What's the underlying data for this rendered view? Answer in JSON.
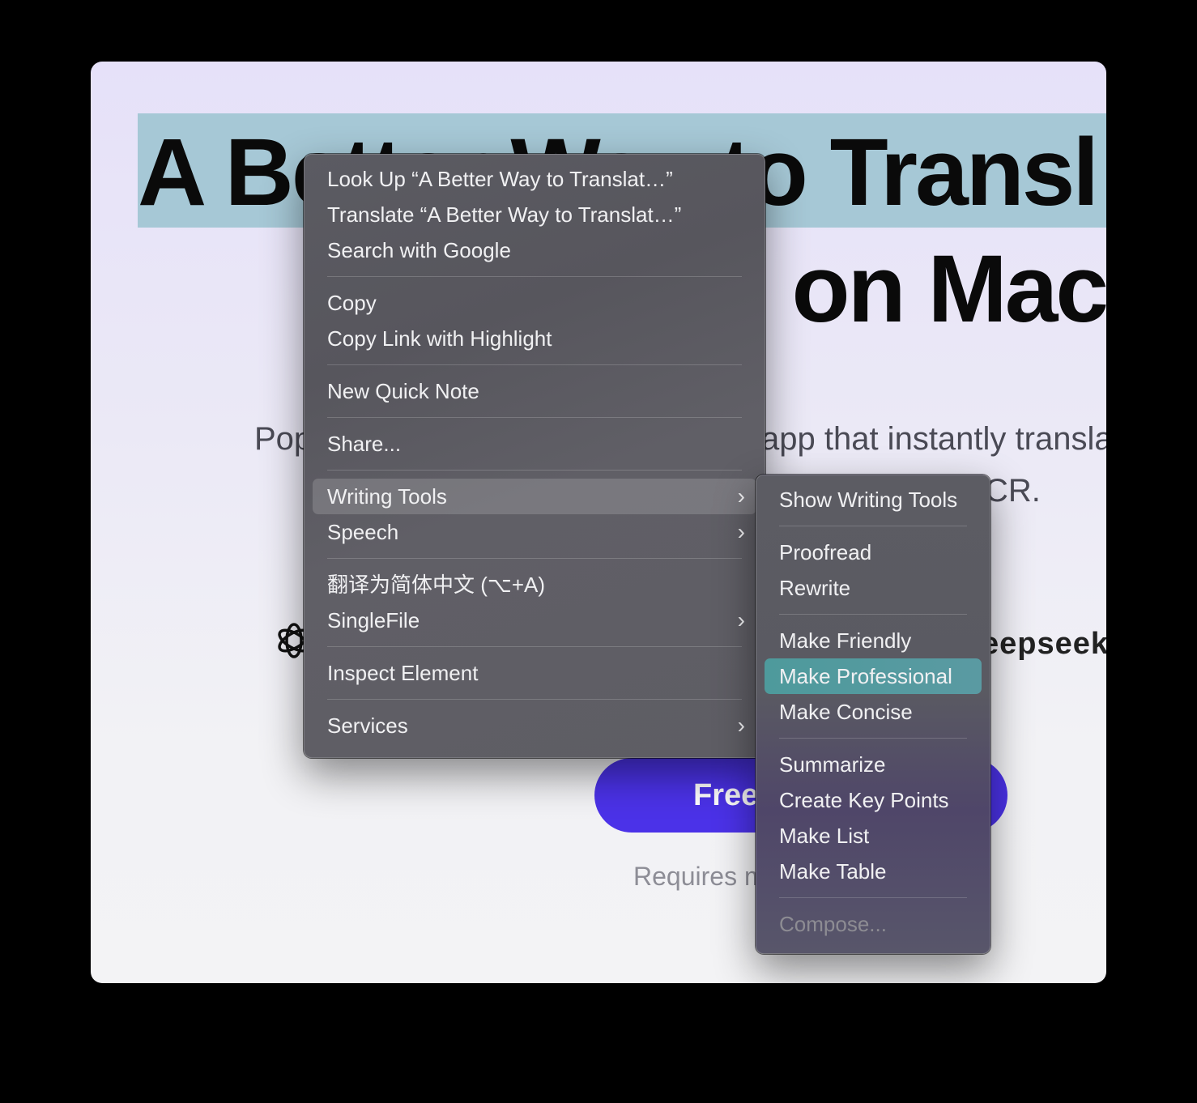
{
  "page": {
    "headline_line1": "A Better Way to Transl",
    "headline_line2": "l on Mac",
    "sub_left": "Pop",
    "sub_line1": "app that instantly transla",
    "sub_line2": "CR.",
    "logo_right": "eepseek",
    "cta_label": "Free",
    "requires": "Requires m"
  },
  "context_menu": {
    "items": [
      {
        "label": "Look Up “A Better Way to Translat…”"
      },
      {
        "label": "Translate “A Better Way to Translat…”"
      },
      {
        "label": "Search with Google"
      },
      {
        "label": "Copy"
      },
      {
        "label": "Copy Link with Highlight"
      },
      {
        "label": "New Quick Note"
      },
      {
        "label": "Share..."
      },
      {
        "label": "Writing Tools"
      },
      {
        "label": "Speech"
      },
      {
        "label": "翻译为简体中文 (⌥+A)"
      },
      {
        "label": "SingleFile"
      },
      {
        "label": "Inspect Element"
      },
      {
        "label": "Services"
      }
    ]
  },
  "writing_tools_menu": {
    "items": [
      {
        "label": "Show Writing Tools"
      },
      {
        "label": "Proofread"
      },
      {
        "label": "Rewrite"
      },
      {
        "label": "Make Friendly"
      },
      {
        "label": "Make Professional"
      },
      {
        "label": "Make Concise"
      },
      {
        "label": "Summarize"
      },
      {
        "label": "Create Key Points"
      },
      {
        "label": "Make List"
      },
      {
        "label": "Make Table"
      },
      {
        "label": "Compose..."
      }
    ]
  },
  "colors": {
    "highlight": "#a6c8d6",
    "cta": "#4b32e8",
    "selected_item": "#4e9a9c"
  }
}
